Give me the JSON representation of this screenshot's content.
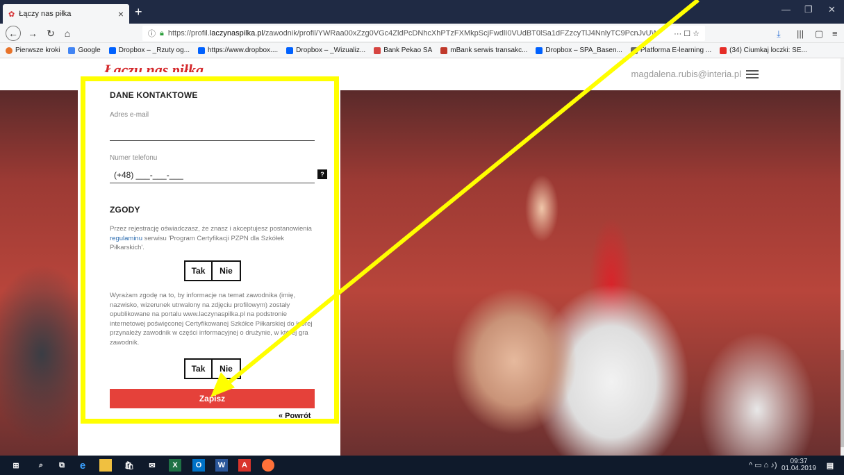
{
  "browser": {
    "tab_title": "Łączy nas piłka",
    "tab_close": "×",
    "new_tab": "+",
    "url_prefix": "https://profil.",
    "url_host": "laczynaspilka.pl",
    "url_path": "/zawodnik/profil/YWRaa00xZzg0VGc4ZldPcDNhcXhPTzFXMkpScjFwdlI0VUdBT0lSa1dFZzcyTlJ4NnlyTC9PcnJvUW",
    "url_actions": "··· ☐ ☆",
    "bookmarks": [
      {
        "label": "Pierwsze kroki",
        "color": "#e8732a"
      },
      {
        "label": "Google",
        "color": "#4285f4"
      },
      {
        "label": "Dropbox – _Rzuty og...",
        "color": "#0061fe"
      },
      {
        "label": "https://www.dropbox....",
        "color": "#0061fe"
      },
      {
        "label": "Dropbox – _Wizualiz...",
        "color": "#0061fe"
      },
      {
        "label": "Bank Pekao SA",
        "color": "#d64541"
      },
      {
        "label": "mBank serwis transakc...",
        "color": "#c0392b"
      },
      {
        "label": "Dropbox – SPA_Basen...",
        "color": "#0061fe"
      },
      {
        "label": "Platforma E-learning ...",
        "color": "#666666"
      },
      {
        "label": "(34) Ciumkaj loczki: SE...",
        "color": "#e52d27"
      }
    ]
  },
  "site": {
    "logo": "Łaczu nas piłka",
    "user_email": "magdalena.rubis@interia.pl"
  },
  "form": {
    "contact_title": "DANE KONTAKTOWE",
    "email_label": "Adres e-mail",
    "phone_label": "Numer telefonu",
    "phone_value": "(+48) ___-___-___",
    "help_label": "?",
    "consents_title": "ZGODY",
    "consent1_before": "Przez rejestrację oświadczasz, że znasz i akceptujesz postanowienia ",
    "consent1_link": "regulaminu",
    "consent1_after": " serwisu 'Program Certyfikacji PZPN dla Szkółek Piłkarskich'.",
    "consent2": "Wyrażam zgodę na to, by informacje na temat zawodnika (imię, nazwisko, wizerunek utrwalony na zdjęciu profilowym) zostały opublikowane na portalu www.laczynaspilka.pl na podstronie internetowej poświęconej Certyfikowanej Szkółce Piłkarskiej do której przynależy zawodnik w części informacyjnej o drużynie, w której gra zawodnik.",
    "yes_label": "Tak",
    "no_label": "Nie",
    "save_label": "Zapisz",
    "back_label": "« Powrót"
  },
  "annotation": {
    "frame_color": "#ffff00",
    "arrow_color": "#ffff00"
  },
  "taskbar": {
    "time": "09:37",
    "date": "01.04.2019"
  },
  "colors": {
    "brand_red": "#d4282b",
    "save_button": "#e5413a",
    "link_blue": "#2b6cb0"
  }
}
